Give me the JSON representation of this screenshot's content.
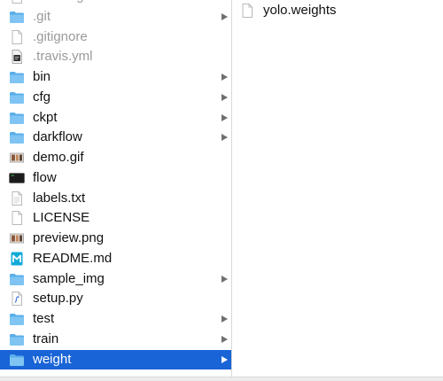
{
  "column1": {
    "items": [
      {
        "name": ".coveragerc",
        "kind": "file",
        "icon": "document-icon",
        "hidden": true,
        "folder": false,
        "selected": false
      },
      {
        "name": ".git",
        "kind": "folder",
        "icon": "folder-icon",
        "hidden": true,
        "folder": true,
        "selected": false
      },
      {
        "name": ".gitignore",
        "kind": "file",
        "icon": "document-icon",
        "hidden": true,
        "folder": false,
        "selected": false
      },
      {
        "name": ".travis.yml",
        "kind": "yml",
        "icon": "yml-file-icon",
        "hidden": true,
        "folder": false,
        "selected": false
      },
      {
        "name": "bin",
        "kind": "folder",
        "icon": "folder-icon",
        "hidden": false,
        "folder": true,
        "selected": false
      },
      {
        "name": "cfg",
        "kind": "folder",
        "icon": "folder-icon",
        "hidden": false,
        "folder": true,
        "selected": false
      },
      {
        "name": "ckpt",
        "kind": "folder",
        "icon": "folder-icon",
        "hidden": false,
        "folder": true,
        "selected": false
      },
      {
        "name": "darkflow",
        "kind": "folder",
        "icon": "folder-icon",
        "hidden": false,
        "folder": true,
        "selected": false
      },
      {
        "name": "demo.gif",
        "kind": "image",
        "icon": "image-thumbnail-icon",
        "hidden": false,
        "folder": false,
        "selected": false
      },
      {
        "name": "flow",
        "kind": "exec",
        "icon": "terminal-executable-icon",
        "hidden": false,
        "folder": false,
        "selected": false
      },
      {
        "name": "labels.txt",
        "kind": "text",
        "icon": "text-document-icon",
        "hidden": false,
        "folder": false,
        "selected": false
      },
      {
        "name": "LICENSE",
        "kind": "file",
        "icon": "document-icon",
        "hidden": false,
        "folder": false,
        "selected": false
      },
      {
        "name": "preview.png",
        "kind": "image",
        "icon": "image-thumbnail-icon",
        "hidden": false,
        "folder": false,
        "selected": false
      },
      {
        "name": "README.md",
        "kind": "markdown",
        "icon": "markdown-icon",
        "hidden": false,
        "folder": false,
        "selected": false
      },
      {
        "name": "sample_img",
        "kind": "folder",
        "icon": "folder-icon",
        "hidden": false,
        "folder": true,
        "selected": false
      },
      {
        "name": "setup.py",
        "kind": "python",
        "icon": "python-file-icon",
        "hidden": false,
        "folder": false,
        "selected": false
      },
      {
        "name": "test",
        "kind": "folder",
        "icon": "folder-icon",
        "hidden": false,
        "folder": true,
        "selected": false
      },
      {
        "name": "train",
        "kind": "folder",
        "icon": "folder-icon",
        "hidden": false,
        "folder": true,
        "selected": false
      },
      {
        "name": "weight",
        "kind": "folder",
        "icon": "folder-icon",
        "hidden": false,
        "folder": true,
        "selected": true
      }
    ]
  },
  "column2": {
    "items": [
      {
        "name": "yolo.weights",
        "kind": "file",
        "icon": "document-icon",
        "hidden": false,
        "folder": false,
        "selected": false
      }
    ]
  },
  "colors": {
    "selection": "#1964d6",
    "folder_light": "#7fc4f3",
    "folder_dark": "#5aaee9",
    "hidden_text": "#9a9a9a",
    "arrow": "#6f6f6f"
  }
}
